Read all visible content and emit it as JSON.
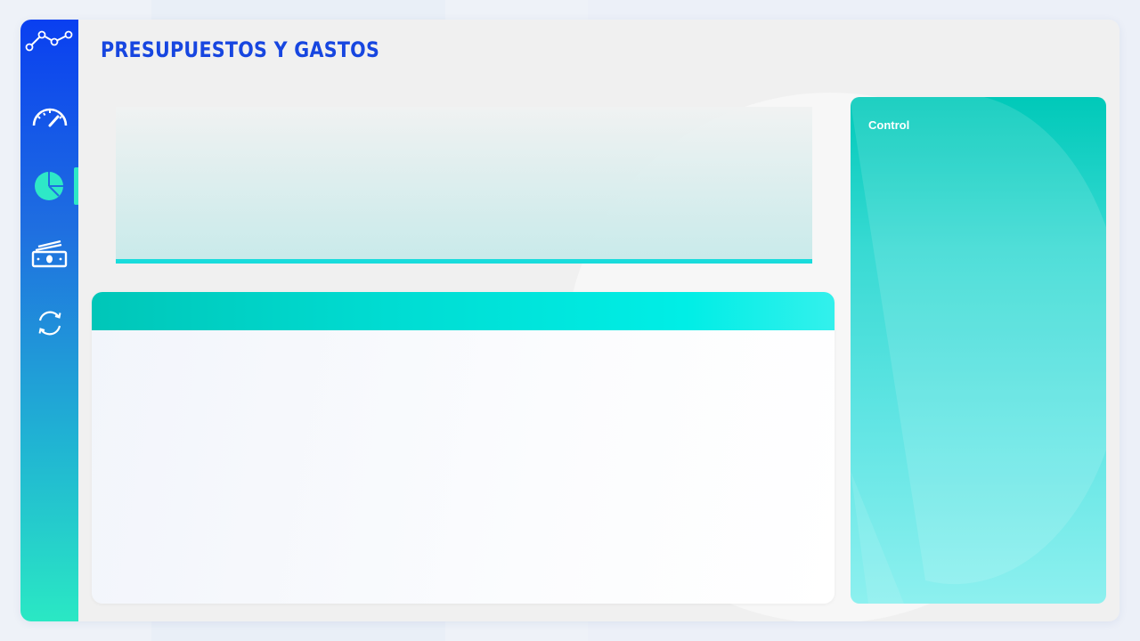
{
  "page": {
    "title": "PRESUPUESTOS Y GASTOS"
  },
  "sidebar": {
    "logo_icon": "line-chart-icon",
    "items": [
      {
        "id": "dashboard",
        "icon": "speedometer-icon",
        "active": false
      },
      {
        "id": "budget",
        "icon": "pie-chart-icon",
        "active": true
      },
      {
        "id": "expenses",
        "icon": "money-icon",
        "active": false
      },
      {
        "id": "refresh",
        "icon": "refresh-icon",
        "active": false
      }
    ]
  },
  "control_panel": {
    "label": "Control"
  },
  "colors": {
    "title": "#1746e0",
    "sidebar_top": "#0a3ff0",
    "sidebar_bottom": "#2ae8c4",
    "accent": "#00dcd2",
    "active_marker": "#2ee8c7"
  }
}
